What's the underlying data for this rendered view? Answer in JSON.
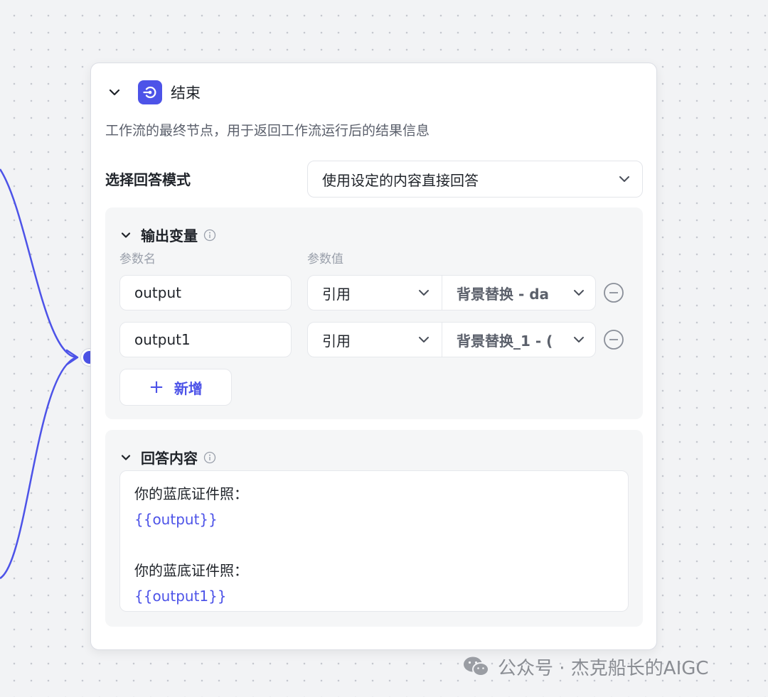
{
  "node": {
    "title": "结束",
    "description": "工作流的最终节点，用于返回工作流运行后的结果信息"
  },
  "answer_mode": {
    "label": "选择回答模式",
    "selected": "使用设定的内容直接回答"
  },
  "output_vars": {
    "title": "输出变量",
    "col_name": "参数名",
    "col_value": "参数值",
    "rows": [
      {
        "name": "output",
        "type": "引用",
        "value": "背景替换 - da"
      },
      {
        "name": "output1",
        "type": "引用",
        "value": "背景替换_1 - ("
      }
    ],
    "add_label": "新增"
  },
  "answer_content": {
    "title": "回答内容",
    "lines": [
      "你的蓝底证件照：",
      "{{output}}",
      "",
      "你的蓝底证件照：",
      "{{output1}}"
    ]
  },
  "watermark": "公众号 · 杰克船长的AIGC",
  "colors": {
    "accent": "#4d53e8",
    "canvas": "#f2f3f5",
    "panel": "#f5f6f7"
  }
}
